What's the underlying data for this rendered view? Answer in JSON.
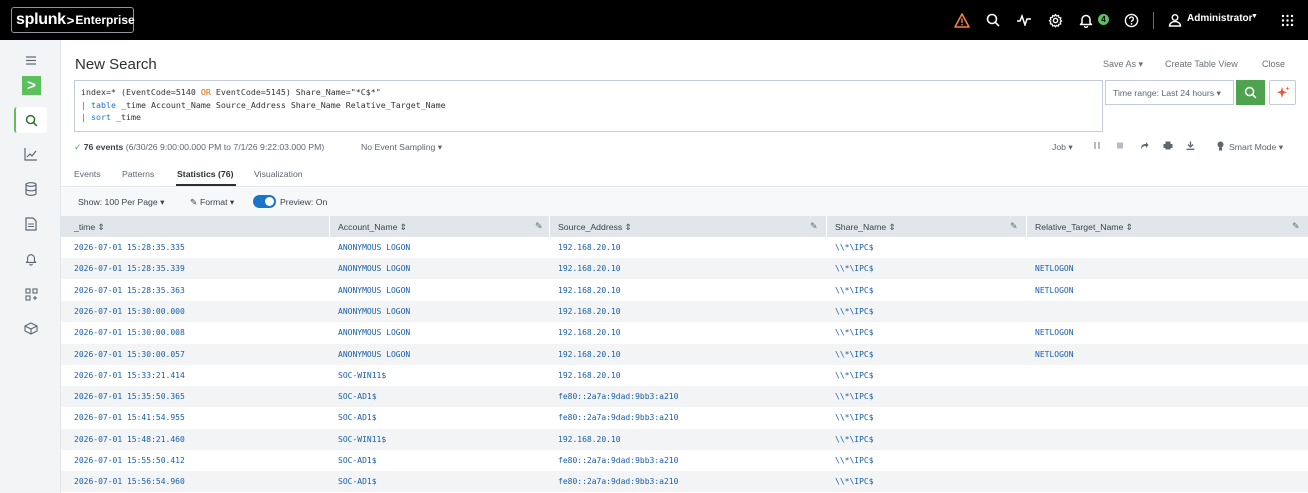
{
  "topbar": {
    "logo_main": "splunk",
    "logo_chevron": ">",
    "logo_product": "Enterprise",
    "notification_count": "4",
    "user_name": "Administrator",
    "icons": [
      "warning-icon",
      "search-icon",
      "activity-icon",
      "gear-icon",
      "bell-icon",
      "help-icon",
      "user-icon",
      "apps-grid-icon"
    ]
  },
  "leftnav": {
    "icons": [
      "menu-icon",
      "app-launcher-icon",
      "search-icon",
      "chart-icon",
      "datasets-icon",
      "reports-icon",
      "alerts-icon",
      "dashboards-icon",
      "packages-icon"
    ],
    "launcher_glyph": ">"
  },
  "header": {
    "title": "New Search",
    "save_as": "Save As ▾",
    "create_table_view": "Create Table View",
    "close": "Close"
  },
  "search": {
    "line1_a": "index=* (EventCode=5140 ",
    "line1_or": "OR",
    "line1_b": " EventCode=5145) Share_Name=\"*C$*\"",
    "line2_pipe": "| ",
    "line2_cmd": "table",
    "line2_rest": " _time Account_Name Source_Address Share_Name Relative_Target_Name",
    "line3_pipe": "| ",
    "line3_cmd": "sort",
    "line3_rest": " _time",
    "time_range": "Time range: Last 24 hours ▾"
  },
  "status": {
    "check": "✓",
    "events": "76 events",
    "range": " (6/30/26 9:00:00.000 PM to 7/1/26 9:22:03.000 PM)",
    "sampling": "No Event Sampling ▾",
    "job": "Job ▾",
    "smart_mode": "Smart Mode ▾"
  },
  "tabs": [
    {
      "label": "Events"
    },
    {
      "label": "Patterns"
    },
    {
      "label": "Statistics (76)"
    },
    {
      "label": "Visualization"
    }
  ],
  "controls": {
    "per_page": "Show: 100 Per Page ▾",
    "format": "Format ▾",
    "preview": "Preview: On"
  },
  "table": {
    "columns": [
      "_time ⇕",
      "Account_Name ⇕",
      "Source_Address ⇕",
      "Share_Name ⇕",
      "Relative_Target_Name ⇕"
    ],
    "rows": [
      [
        "2026-07-01 15:28:35.335",
        "ANONYMOUS LOGON",
        "192.168.20.10",
        "\\\\*\\IPC$",
        ""
      ],
      [
        "2026-07-01 15:28:35.339",
        "ANONYMOUS LOGON",
        "192.168.20.10",
        "\\\\*\\IPC$",
        "NETLOGON"
      ],
      [
        "2026-07-01 15:28:35.363",
        "ANONYMOUS LOGON",
        "192.168.20.10",
        "\\\\*\\IPC$",
        "NETLOGON"
      ],
      [
        "2026-07-01 15:30:00.000",
        "ANONYMOUS LOGON",
        "192.168.20.10",
        "\\\\*\\IPC$",
        ""
      ],
      [
        "2026-07-01 15:30:00.008",
        "ANONYMOUS LOGON",
        "192.168.20.10",
        "\\\\*\\IPC$",
        "NETLOGON"
      ],
      [
        "2026-07-01 15:30:00.057",
        "ANONYMOUS LOGON",
        "192.168.20.10",
        "\\\\*\\IPC$",
        "NETLOGON"
      ],
      [
        "2026-07-01 15:33:21.414",
        "SOC-WIN11$",
        "192.168.20.10",
        "\\\\*\\IPC$",
        ""
      ],
      [
        "2026-07-01 15:35:50.365",
        "SOC-AD1$",
        "fe80::2a7a:9dad:9bb3:a210",
        "\\\\*\\IPC$",
        ""
      ],
      [
        "2026-07-01 15:41:54.955",
        "SOC-AD1$",
        "fe80::2a7a:9dad:9bb3:a210",
        "\\\\*\\IPC$",
        ""
      ],
      [
        "2026-07-01 15:48:21.460",
        "SOC-WIN11$",
        "192.168.20.10",
        "\\\\*\\IPC$",
        ""
      ],
      [
        "2026-07-01 15:55:50.412",
        "SOC-AD1$",
        "fe80::2a7a:9dad:9bb3:a210",
        "\\\\*\\IPC$",
        ""
      ],
      [
        "2026-07-01 15:56:54.960",
        "SOC-AD1$",
        "fe80::2a7a:9dad:9bb3:a210",
        "\\\\*\\IPC$",
        ""
      ]
    ]
  }
}
